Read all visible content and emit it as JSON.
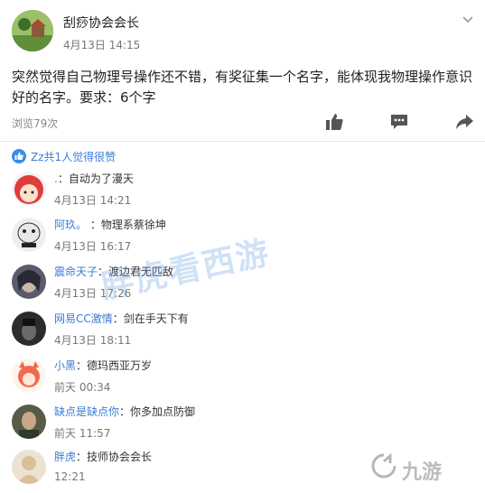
{
  "post": {
    "author": "刮痧协会会长",
    "time": "4月13日 14:15",
    "body": "突然觉得自己物理号操作还不错，有奖征集一个名字，能体现我物理操作意识好的名字。要求：6个字",
    "views": "浏览79次",
    "icons": [
      "chevron-down-icon",
      "thumbs-up-icon",
      "comment-icon",
      "share-icon"
    ],
    "colors": {
      "link": "#3a7bd5",
      "icon": "#555555",
      "like_badge": "#3a8ee6"
    }
  },
  "likes": {
    "text": "Zz共1人觉得很赞"
  },
  "comments": [
    {
      "name": ".",
      "sep": "：",
      "text": "自动为了漫天",
      "time": "4月13日 14:21",
      "avatar_color": "#e03c3c"
    },
    {
      "name": "阿玖。",
      "sep": " ：",
      "text": "物理系蔡徐坤",
      "time": "4月13日 16:17",
      "avatar_color": "#dcdcdc"
    },
    {
      "name": "震命天子",
      "sep": "：",
      "text": "渡边君无匹敌",
      "time": "4月13日 17:26",
      "avatar_color": "#6a6a7a"
    },
    {
      "name": "网易CC激情",
      "sep": "：",
      "text": "剑在手天下有",
      "time": "4月13日 18:11",
      "avatar_color": "#3b3b3b"
    },
    {
      "name": "小黑",
      "sep": "：",
      "text": "德玛西亚万岁",
      "time": "前天 00:34",
      "avatar_color": "#f06b4e"
    },
    {
      "name": "缺点是缺点你",
      "sep": "：",
      "text": "你多加点防御",
      "time": "前天 11:57",
      "avatar_color": "#4a4a3a"
    },
    {
      "name": "胖虎",
      "sep": "：",
      "text": "技师协会会长",
      "time": "12:21",
      "avatar_color": "#e8d2b0"
    }
  ],
  "watermark": "胖虎看西游",
  "brand": "九游"
}
